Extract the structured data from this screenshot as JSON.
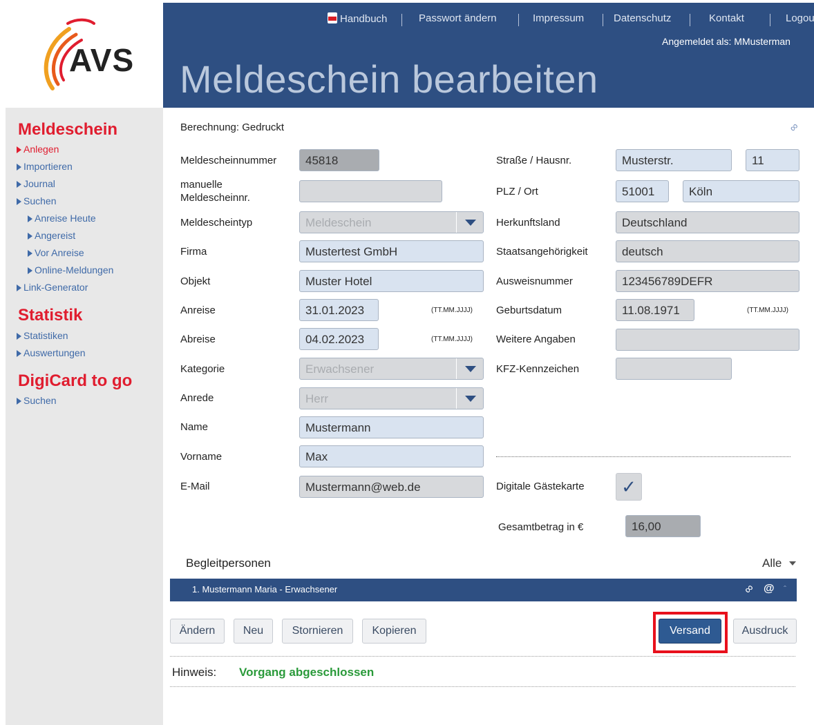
{
  "logo": {
    "text": "AVS"
  },
  "header": {
    "nav": [
      {
        "label": "Handbuch",
        "icon": "pdf-icon"
      },
      {
        "label": "Passwort ändern"
      },
      {
        "label": "Impressum"
      },
      {
        "label": "Datenschutz"
      },
      {
        "label": "Kontakt"
      },
      {
        "label": "Logou"
      }
    ],
    "logged_in": "Angemeldet als: MMusterman",
    "title": "Meldeschein bearbeiten"
  },
  "sidebar": {
    "sections": [
      {
        "title": "Meldeschein",
        "items": [
          "Anlegen",
          "Importieren",
          "Journal",
          "Suchen"
        ],
        "subitems": [
          "Anreise Heute",
          "Angereist",
          "Vor Anreise",
          "Online-Meldungen"
        ],
        "after": [
          "Link-Generator"
        ]
      },
      {
        "title": "Statistik",
        "items": [
          "Statistiken",
          "Auswertungen"
        ]
      },
      {
        "title": "DigiCard to go",
        "items": [
          "Suchen"
        ]
      }
    ]
  },
  "form": {
    "berechnung": "Berechnung: Gedruckt",
    "left": {
      "meldescheinnummer": {
        "label": "Meldescheinnummer",
        "value": "45818"
      },
      "manuelle": {
        "label": "manuelle\nMeldescheinnr.",
        "value": ""
      },
      "typ": {
        "label": "Meldescheintyp",
        "value": "Meldeschein"
      },
      "firma": {
        "label": "Firma",
        "value": "Mustertest GmbH"
      },
      "objekt": {
        "label": "Objekt",
        "value": "Muster Hotel"
      },
      "anreise": {
        "label": "Anreise",
        "value": "31.01.2023",
        "format": "(TT.MM.JJJJ)"
      },
      "abreise": {
        "label": "Abreise",
        "value": "04.02.2023",
        "format": "(TT.MM.JJJJ)"
      },
      "kategorie": {
        "label": "Kategorie",
        "value": "Erwachsener"
      },
      "anrede": {
        "label": "Anrede",
        "value": "Herr"
      },
      "name": {
        "label": "Name",
        "value": "Mustermann"
      },
      "vorname": {
        "label": "Vorname",
        "value": "Max"
      },
      "email": {
        "label": "E-Mail",
        "value": "Mustermann@web.de"
      }
    },
    "right": {
      "strasse": {
        "label": "Straße / Hausnr.",
        "value": "Musterstr.",
        "nr": "11"
      },
      "plz": {
        "label": "PLZ / Ort",
        "value": "51001",
        "ort": "Köln"
      },
      "herkunft": {
        "label": "Herkunftsland",
        "value": "Deutschland"
      },
      "staat": {
        "label": "Staatsangehörigkeit",
        "value": "deutsch"
      },
      "ausweis": {
        "label": "Ausweisnummer",
        "value": "123456789DEFR"
      },
      "geburt": {
        "label": "Geburtsdatum",
        "value": "11.08.1971",
        "format": "(TT.MM.JJJJ)"
      },
      "weitere": {
        "label": "Weitere Angaben",
        "value": ""
      },
      "kfz": {
        "label": "KFZ-Kennzeichen",
        "value": ""
      },
      "gaestekarte": {
        "label": "Digitale Gästekarte",
        "checked": "✓"
      },
      "gesamt": {
        "label": "Gesamtbetrag in €",
        "value": "16,00"
      }
    }
  },
  "begleit": {
    "title": "Begleitpersonen",
    "filter": "Alle",
    "row": "1. Mustermann Maria - Erwachsener"
  },
  "buttons": {
    "aendern": "Ändern",
    "neu": "Neu",
    "stornieren": "Stornieren",
    "kopieren": "Kopieren",
    "versand": "Versand",
    "ausdruck": "Ausdruck"
  },
  "hinweis": {
    "label": "Hinweis:",
    "text": "Vorgang abgeschlossen"
  },
  "colors": {
    "header": "#2e4f82",
    "accent_red": "#e01d2f",
    "link": "#3f6aa8",
    "highlight": "#e8101c",
    "success": "#2a9a3a"
  }
}
